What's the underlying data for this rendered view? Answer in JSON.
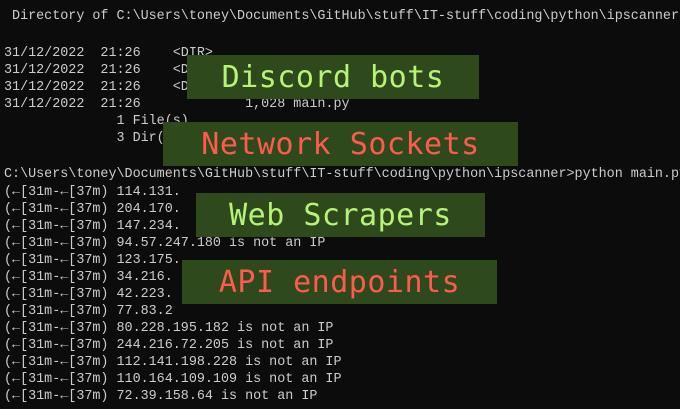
{
  "terminal": {
    "header_line": " Directory of C:\\Users\\toney\\Documents\\GitHub\\stuff\\IT-stuff\\coding\\python\\ipscanner",
    "dir_lines": [
      "31/12/2022  21:26    <DIR>",
      "31/12/2022  21:26    <DIR>",
      "31/12/2022  21:26    <DIR>",
      "31/12/2022  21:26             1,028 main.py"
    ],
    "summary_lines": [
      "              1 File(s)",
      "              3 Dir(s)"
    ],
    "prompt_line": "C:\\Users\\toney\\Documents\\GitHub\\stuff\\IT-stuff\\coding\\python\\ipscanner>python main.py",
    "output_lines": [
      "(←[31m-←[37m) 114.131.",
      "(←[31m-←[37m) 204.170.",
      "(←[31m-←[37m) 147.234.",
      "(←[31m-←[37m) 94.57.247.180 is not an IP",
      "(←[31m-←[37m) 123.175.",
      "(←[31m-←[37m) 34.216.",
      "(←[31m-←[37m) 42.223.",
      "(←[31m-←[37m) 77.83.2",
      "(←[31m-←[37m) 80.228.195.182 is not an IP",
      "(←[31m-←[37m) 244.216.72.205 is not an IP",
      "(←[31m-←[37m) 112.141.198.228 is not an IP",
      "(←[31m-←[37m) 110.164.109.109 is not an IP",
      "(←[31m-←[37m) 72.39.158.64 is not an IP"
    ]
  },
  "banners": [
    {
      "label": "Discord bots",
      "style": "green"
    },
    {
      "label": "Network Sockets",
      "style": "red"
    },
    {
      "label": "Web Scrapers",
      "style": "green"
    },
    {
      "label": "API endpoints",
      "style": "red"
    }
  ],
  "colors": {
    "terminal_bg": "#0c0c0c",
    "terminal_text": "#cccccc",
    "banner_bg": "#2e4a1c",
    "banner_green_text": "#b8f276",
    "banner_red_text": "#ff5a4e"
  }
}
